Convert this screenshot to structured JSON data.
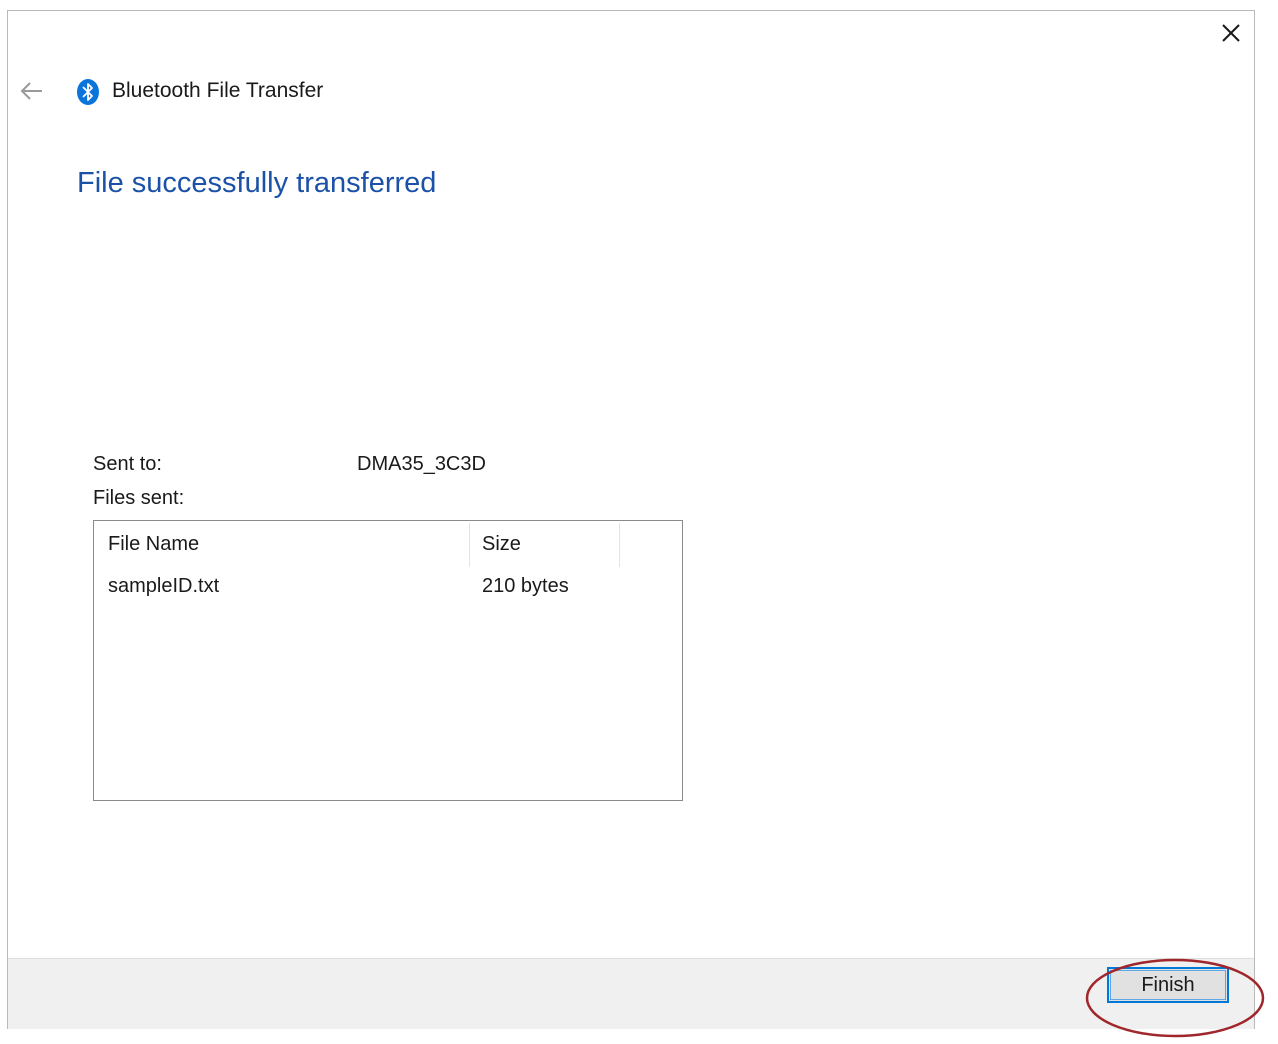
{
  "window": {
    "title": "Bluetooth File Transfer",
    "close_glyph": "×",
    "back_icon": "back-arrow-icon",
    "app_icon": "bluetooth-icon"
  },
  "main": {
    "heading": "File successfully transferred",
    "sent_to_label": "Sent to:",
    "sent_to_value": "DMA35_3C3D",
    "files_sent_label": "Files sent:"
  },
  "files_table": {
    "columns": [
      "File Name",
      "Size"
    ],
    "rows": [
      {
        "name": "sampleID.txt",
        "size": "210 bytes"
      }
    ]
  },
  "footer": {
    "finish_label": "Finish"
  },
  "colors": {
    "heading": "#1b52a8",
    "accent": "#0078d7",
    "annotation": "#a0262c"
  }
}
